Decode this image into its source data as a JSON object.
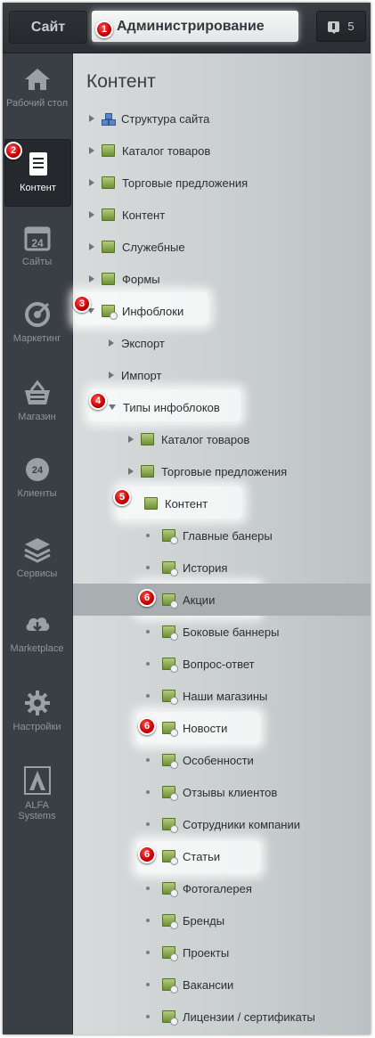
{
  "topbar": {
    "site_label": "Сайт",
    "admin_label": "Администрирование",
    "notifications_count": "5"
  },
  "markers": [
    "1",
    "2",
    "3",
    "4",
    "5",
    "6"
  ],
  "nav": [
    {
      "label": "Рабочий стол",
      "icon": "home-icon"
    },
    {
      "label": "Контент",
      "icon": "document-icon"
    },
    {
      "label": "Сайты",
      "icon": "calendar-icon"
    },
    {
      "label": "Маркетинг",
      "icon": "target-icon"
    },
    {
      "label": "Магазин",
      "icon": "basket-icon"
    },
    {
      "label": "Клиенты",
      "icon": "clients-icon"
    },
    {
      "label": "Сервисы",
      "icon": "layers-icon"
    },
    {
      "label": "Marketplace",
      "icon": "cloud-download-icon"
    },
    {
      "label": "Настройки",
      "icon": "gear-icon"
    },
    {
      "label": "ALFA Systems",
      "icon": "alfa-logo-icon"
    }
  ],
  "nav_calendar_number": "24",
  "nav_clients_number": "24",
  "content": {
    "title": "Контент",
    "items": [
      {
        "label": "Структура сайта"
      },
      {
        "label": "Каталог товаров"
      },
      {
        "label": "Торговые предложения"
      },
      {
        "label": "Контент"
      },
      {
        "label": "Служебные"
      },
      {
        "label": "Формы"
      },
      {
        "label": "Инфоблоки"
      },
      {
        "label": "Экспорт"
      },
      {
        "label": "Импорт"
      },
      {
        "label": "Типы инфоблоков"
      },
      {
        "label": "Каталог товаров"
      },
      {
        "label": "Торговые предложения"
      },
      {
        "label": "Контент"
      },
      {
        "label": "Главные банеры"
      },
      {
        "label": "История"
      },
      {
        "label": "Акции"
      },
      {
        "label": "Боковые баннеры"
      },
      {
        "label": "Вопрос-ответ"
      },
      {
        "label": "Наши магазины"
      },
      {
        "label": "Новости"
      },
      {
        "label": "Особенности"
      },
      {
        "label": "Отзывы клиентов"
      },
      {
        "label": "Сотрудники компании"
      },
      {
        "label": "Статьи"
      },
      {
        "label": "Фотогалерея"
      },
      {
        "label": "Бренды"
      },
      {
        "label": "Проекты"
      },
      {
        "label": "Вакансии"
      },
      {
        "label": "Лицензии / сертификаты"
      }
    ]
  },
  "colors": {
    "marker": "#d40000",
    "selected_row": "#a9afb1",
    "sidebar": "#3a3f45"
  }
}
